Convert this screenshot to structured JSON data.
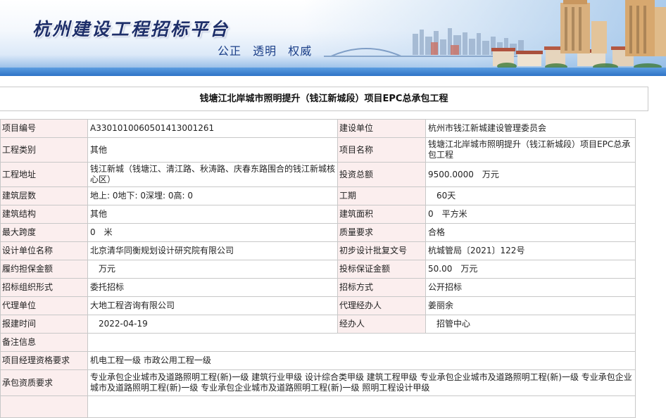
{
  "header": {
    "site_title": "杭州建设工程招标平台",
    "slogan": [
      "公正",
      "透明",
      "权威"
    ]
  },
  "project": {
    "title": "钱塘江北岸城市照明提升（钱江新城段）项目EPC总承包工程"
  },
  "info": {
    "rows": [
      {
        "l1": "项目编号",
        "v1": "A3301010060501413001261",
        "l2": "建设单位",
        "v2": "杭州市钱江新城建设管理委员会"
      },
      {
        "l1": "工程类别",
        "v1": "其他",
        "l2": "项目名称",
        "v2": "钱塘江北岸城市照明提升（钱江新城段）项目EPC总承包工程"
      },
      {
        "l1": "工程地址",
        "v1": "钱江新城（钱塘江、清江路、秋涛路、庆春东路围合的钱江新城核心区）",
        "l2": "投资总额",
        "v2": "9500.0000　万元"
      },
      {
        "l1": "建筑层数",
        "v1": "地上: 0地下: 0深埋: 0高: 0",
        "l2": "工期",
        "v2": "　60天"
      },
      {
        "l1": "建筑结构",
        "v1": "其他",
        "l2": "建筑面积",
        "v2": "0　平方米"
      },
      {
        "l1": "最大跨度",
        "v1": "0　米",
        "l2": "质量要求",
        "v2": "合格"
      },
      {
        "l1": "设计单位名称",
        "v1": "北京清华同衡规划设计研究院有限公司",
        "l2": "初步设计批复文号",
        "v2": "杭城管局〔2021〕122号"
      },
      {
        "l1": "履约担保金额",
        "v1": "　万元",
        "l2": "投标保证金额",
        "v2": "50.00　万元"
      },
      {
        "l1": "招标组织形式",
        "v1": "委托招标",
        "l2": "招标方式",
        "v2": "公开招标"
      },
      {
        "l1": "代理单位",
        "v1": "大地工程咨询有限公司",
        "l2": "代理经办人",
        "v2": "姜丽余"
      },
      {
        "l1": "报建时间",
        "v1": "　2022-04-19",
        "l2": "经办人",
        "v2": "　招管中心"
      }
    ],
    "remarks_label": "备注信息",
    "remarks_value": "",
    "pm_label": "项目经理资格要求",
    "pm_value": "机电工程一级 市政公用工程一级",
    "qual_label": "承包资质要求",
    "qual_value": "专业承包企业城市及道路照明工程(新)一级 建筑行业甲级 设计综合类甲级 建筑工程甲级 专业承包企业城市及道路照明工程(新)一级 专业承包企业城市及道路照明工程(新)一级 专业承包企业城市及道路照明工程(新)一级 照明工程设计甲级"
  }
}
